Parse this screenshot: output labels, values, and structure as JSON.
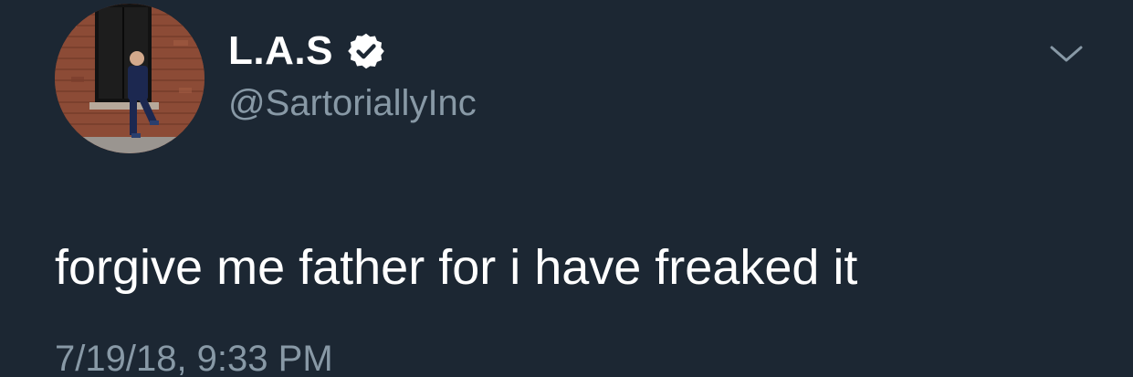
{
  "tweet": {
    "author": {
      "display_name": "L.A.S",
      "handle": "@SartoriallyInc",
      "verified": true,
      "avatar_icon": "profile-photo"
    },
    "text": "forgive me father for i have freaked it",
    "timestamp": "7/19/18, 9:33 PM",
    "menu_icon": "chevron-down-icon"
  },
  "colors": {
    "background": "#1c2733",
    "primary_text": "#ffffff",
    "secondary_text": "#8899a6",
    "verified_badge": "#ffffff"
  }
}
